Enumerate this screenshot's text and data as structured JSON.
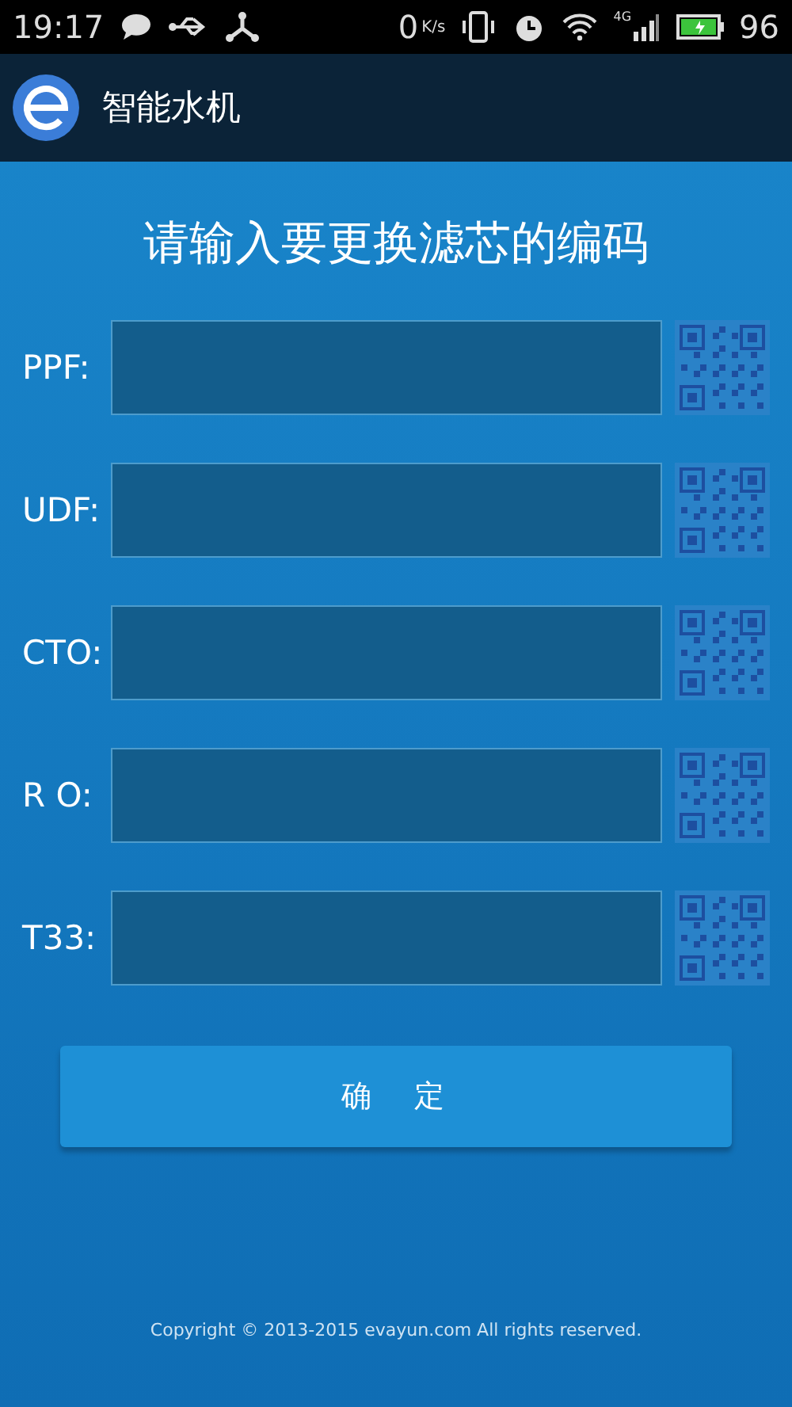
{
  "status_bar": {
    "time": "19:17",
    "speed": "0",
    "speed_unit": "K/s",
    "network": "4G",
    "battery": "96"
  },
  "app_bar": {
    "title": "智能水机"
  },
  "heading": "请输入要更换滤芯的编码",
  "fields": [
    {
      "label": "PPF:"
    },
    {
      "label": "UDF:"
    },
    {
      "label": "CTO:"
    },
    {
      "label": "R O:"
    },
    {
      "label": "T33:"
    }
  ],
  "confirm_button": "确　定",
  "footer": "Copyright ©  2013-2015 evayun.com All rights reserved."
}
